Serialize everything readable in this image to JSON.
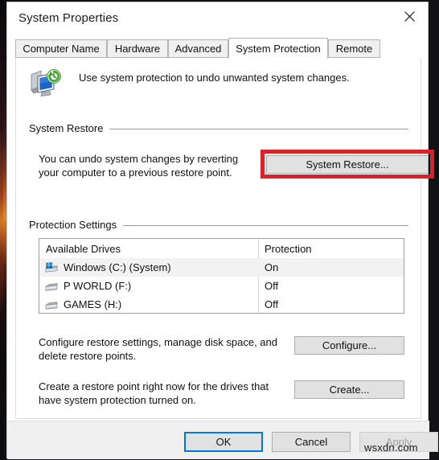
{
  "window": {
    "title": "System Properties",
    "close_icon": "close-icon"
  },
  "tabs": [
    {
      "label": "Computer Name",
      "active": false
    },
    {
      "label": "Hardware",
      "active": false
    },
    {
      "label": "Advanced",
      "active": false
    },
    {
      "label": "System Protection",
      "active": true
    },
    {
      "label": "Remote",
      "active": false
    }
  ],
  "header": {
    "icon": "system-protection-icon",
    "caption": "Use system protection to undo unwanted system changes."
  },
  "system_restore": {
    "group_title": "System Restore",
    "description_line1": "You can undo system changes by reverting",
    "description_line2": "your computer to a previous restore point.",
    "button_label": "System Restore...",
    "highlight_color": "#d8232a"
  },
  "protection_settings": {
    "group_title": "Protection Settings",
    "columns": [
      "Available Drives",
      "Protection"
    ],
    "rows": [
      {
        "icon": "windows-drive-icon",
        "drive": "Windows (C:) (System)",
        "protection": "On",
        "selected": true
      },
      {
        "icon": "drive-icon",
        "drive": "P WORLD (F:)",
        "protection": "Off",
        "selected": false
      },
      {
        "icon": "drive-icon",
        "drive": "GAMES (H:)",
        "protection": "Off",
        "selected": false
      }
    ],
    "configure": {
      "description_line1": "Configure restore settings, manage disk space, and",
      "description_line2": "delete restore points.",
      "button_label": "Configure..."
    },
    "create": {
      "description_line1": "Create a restore point right now for the drives that",
      "description_line2": "have system protection turned on.",
      "button_label": "Create..."
    }
  },
  "footer": {
    "ok_label": "OK",
    "cancel_label": "Cancel",
    "apply_label": "Apply",
    "apply_disabled": true,
    "focus_color": "#0078d7"
  },
  "watermark": "wsxdn.com"
}
